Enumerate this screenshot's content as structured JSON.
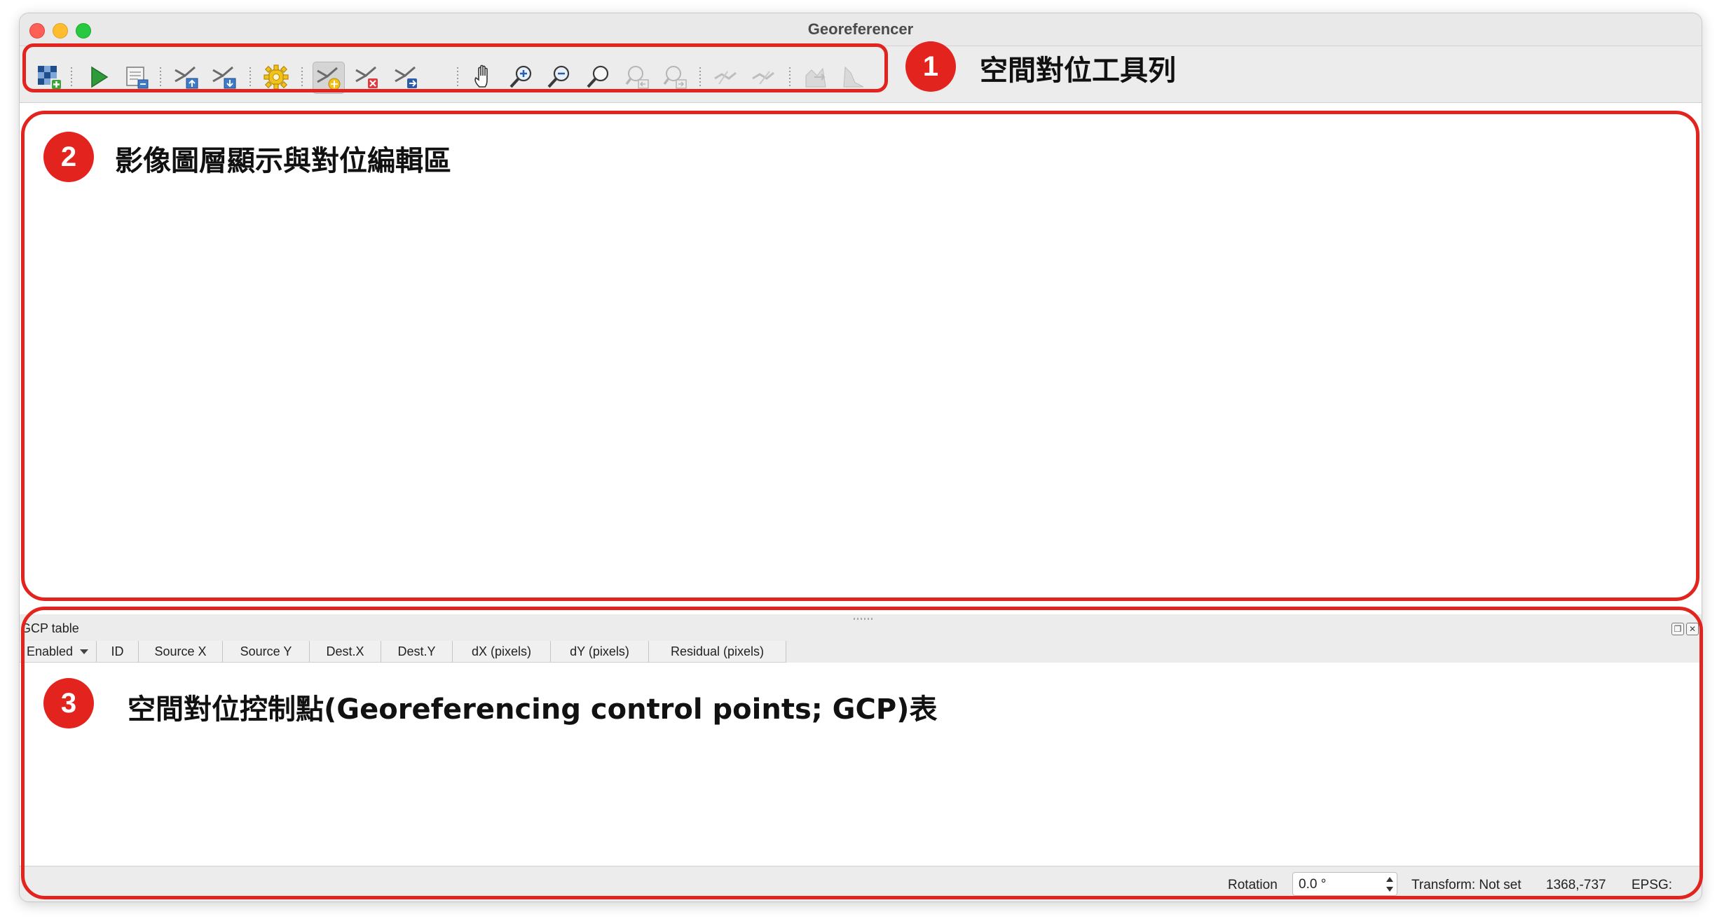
{
  "window": {
    "title": "Georeferencer"
  },
  "toolbar": {
    "buttons": [
      {
        "id": "open-raster",
        "icon": "raster-add-icon",
        "tooltip": ""
      },
      {
        "id": "start-georeferencing",
        "icon": "play-icon"
      },
      {
        "id": "generate-gdal-script",
        "icon": "script-icon"
      },
      {
        "id": "load-gcp-points",
        "icon": "gcp-load-icon"
      },
      {
        "id": "save-gcp-points",
        "icon": "gcp-save-icon"
      },
      {
        "id": "transformation-settings",
        "icon": "gear-icon"
      },
      {
        "id": "add-point",
        "icon": "add-point-icon"
      },
      {
        "id": "delete-point",
        "icon": "delete-point-icon"
      },
      {
        "id": "move-gcp-point",
        "icon": "move-point-icon"
      },
      {
        "id": "pan",
        "icon": "pan-hand-icon"
      },
      {
        "id": "zoom-in",
        "icon": "zoom-in-icon"
      },
      {
        "id": "zoom-out",
        "icon": "zoom-out-icon"
      },
      {
        "id": "zoom-to-layer",
        "icon": "zoom-layer-icon"
      },
      {
        "id": "zoom-last",
        "icon": "zoom-last-icon"
      },
      {
        "id": "zoom-next",
        "icon": "zoom-next-icon"
      },
      {
        "id": "link-georef-to-qgis",
        "icon": "link-georef-icon"
      },
      {
        "id": "link-qgis-to-georef",
        "icon": "link-qgis-icon"
      },
      {
        "id": "full-histogram-stretch",
        "icon": "histogram-full-icon"
      },
      {
        "id": "local-histogram-stretch",
        "icon": "histogram-local-icon"
      }
    ]
  },
  "annotations": {
    "toolbar": {
      "number": "1",
      "label": "空間對位工具列"
    },
    "canvas": {
      "number": "2",
      "label": "影像圖層顯示與對位編輯區"
    },
    "gcp": {
      "number": "3",
      "label": "空間對位控制點(Georeferencing control points; GCP)表"
    },
    "color": "#e3241e"
  },
  "gcp_table": {
    "title": "GCP table",
    "columns": [
      "Enabled",
      "ID",
      "Source X",
      "Source Y",
      "Dest.X",
      "Dest.Y",
      "dX (pixels)",
      "dY (pixels)",
      "Residual (pixels)"
    ]
  },
  "statusbar": {
    "rotation_label": "Rotation",
    "rotation_value": "0.0 °",
    "transform": "Transform: Not set",
    "coordinates": "1368,-737",
    "epsg": "EPSG:"
  }
}
